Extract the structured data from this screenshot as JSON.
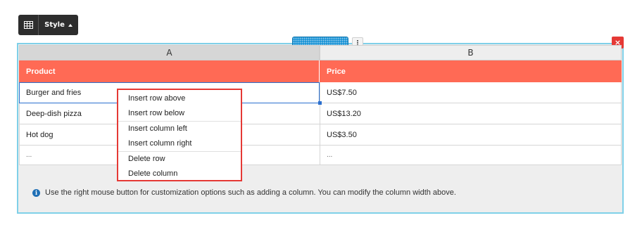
{
  "toolbar": {
    "table_icon": "table-icon",
    "style_label": "Style"
  },
  "controls": {
    "close_label": "×"
  },
  "table": {
    "column_letters": [
      "A",
      "B"
    ],
    "headers": [
      "Product",
      "Price"
    ],
    "rows": [
      [
        "Burger and fries",
        "US$7.50"
      ],
      [
        "Deep-dish pizza",
        "US$13.20"
      ],
      [
        "Hot dog",
        "US$3.50"
      ],
      [
        "...",
        "..."
      ]
    ],
    "header_color": "#ff6a55"
  },
  "context_menu": {
    "groups": [
      [
        "Insert row above",
        "Insert row below"
      ],
      [
        "Insert column left",
        "Insert column right"
      ],
      [
        "Delete row",
        "Delete column"
      ]
    ],
    "highlight_color": "#e53935"
  },
  "info": {
    "icon": "info-icon",
    "text": "Use the right mouse button for customization options such as adding a column. You can modify the column width above."
  }
}
